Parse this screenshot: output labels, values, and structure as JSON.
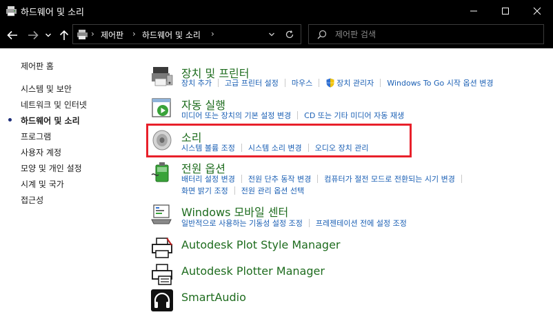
{
  "window": {
    "title": "하드웨어 및 소리"
  },
  "address": {
    "crumbs": [
      "제어판",
      "하드웨어 및 소리"
    ]
  },
  "search": {
    "placeholder": "제어판 검색"
  },
  "sidebar": {
    "items": [
      {
        "label": "제어판 홈"
      },
      {
        "label": "시스템 및 보안"
      },
      {
        "label": "네트워크 및 인터넷"
      },
      {
        "label": "하드웨어 및 소리",
        "active": true
      },
      {
        "label": "프로그램"
      },
      {
        "label": "사용자 계정"
      },
      {
        "label": "모양 및 개인 설정"
      },
      {
        "label": "시계 및 국가"
      },
      {
        "label": "접근성"
      }
    ]
  },
  "categories": [
    {
      "title": "장치 및 프린터",
      "icon": "devices-printers-icon",
      "links": [
        [
          "장치 추가",
          "고급 프린터 설정",
          "마우스",
          "장치 관리자",
          "Windows To Go 시작 옵션 변경"
        ]
      ]
    },
    {
      "title": "자동 실행",
      "icon": "autoplay-icon",
      "links": [
        [
          "미디어 또는 장치의 기본 설정 변경",
          "CD 또는 기타 미디어 자동 재생"
        ]
      ]
    },
    {
      "title": "소리",
      "icon": "speaker-icon",
      "links": [
        [
          "시스템 볼륨 조정",
          "시스템 소리 변경",
          "오디오 장치 관리"
        ]
      ]
    },
    {
      "title": "전원 옵션",
      "icon": "power-options-icon",
      "links": [
        [
          "배터리 설정 변경",
          "전원 단추 동작 변경",
          "컴퓨터가 절전 모드로 전환되는 시기 변경"
        ],
        [
          "화면 밝기 조정",
          "전원 관리 옵션 선택"
        ]
      ]
    },
    {
      "title": "Windows 모바일 센터",
      "icon": "mobility-center-icon",
      "links": [
        [
          "일반적으로 사용하는 기동성 설정 조정",
          "프레젠테이션 전에 설정 조정"
        ]
      ]
    },
    {
      "title": "Autodesk Plot Style Manager",
      "icon": "plot-style-printer-icon",
      "links": []
    },
    {
      "title": "Autodesk Plotter Manager",
      "icon": "plotter-manager-icon",
      "links": []
    },
    {
      "title": "SmartAudio",
      "icon": "headphones-icon",
      "links": []
    }
  ],
  "colors": {
    "titlebar_bg": "#000000",
    "category_title": "#1e6c1e",
    "link": "#1a5fb4",
    "highlight_border": "#e8202a"
  }
}
